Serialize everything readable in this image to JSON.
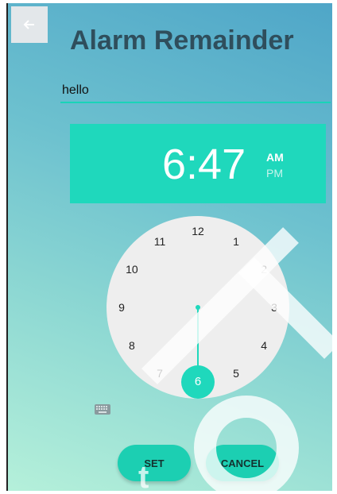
{
  "header": {
    "title": "Alarm Remainder",
    "back_icon": "arrow-left-icon"
  },
  "reminder_input": {
    "value": "hello"
  },
  "time": {
    "display": "6:47",
    "am_label": "AM",
    "pm_label": "PM",
    "selected_period": "AM"
  },
  "clock": {
    "mode": "hours",
    "numbers": [
      "12",
      "1",
      "2",
      "3",
      "4",
      "5",
      "6",
      "7",
      "8",
      "9",
      "10",
      "11"
    ],
    "selected": "6"
  },
  "keyboard_toggle": {
    "icon": "keyboard-icon"
  },
  "actions": {
    "set_label": "SET",
    "cancel_label": "CANCEL"
  },
  "colors": {
    "accent": "#1fd8bc",
    "title": "#2f4e5c"
  }
}
